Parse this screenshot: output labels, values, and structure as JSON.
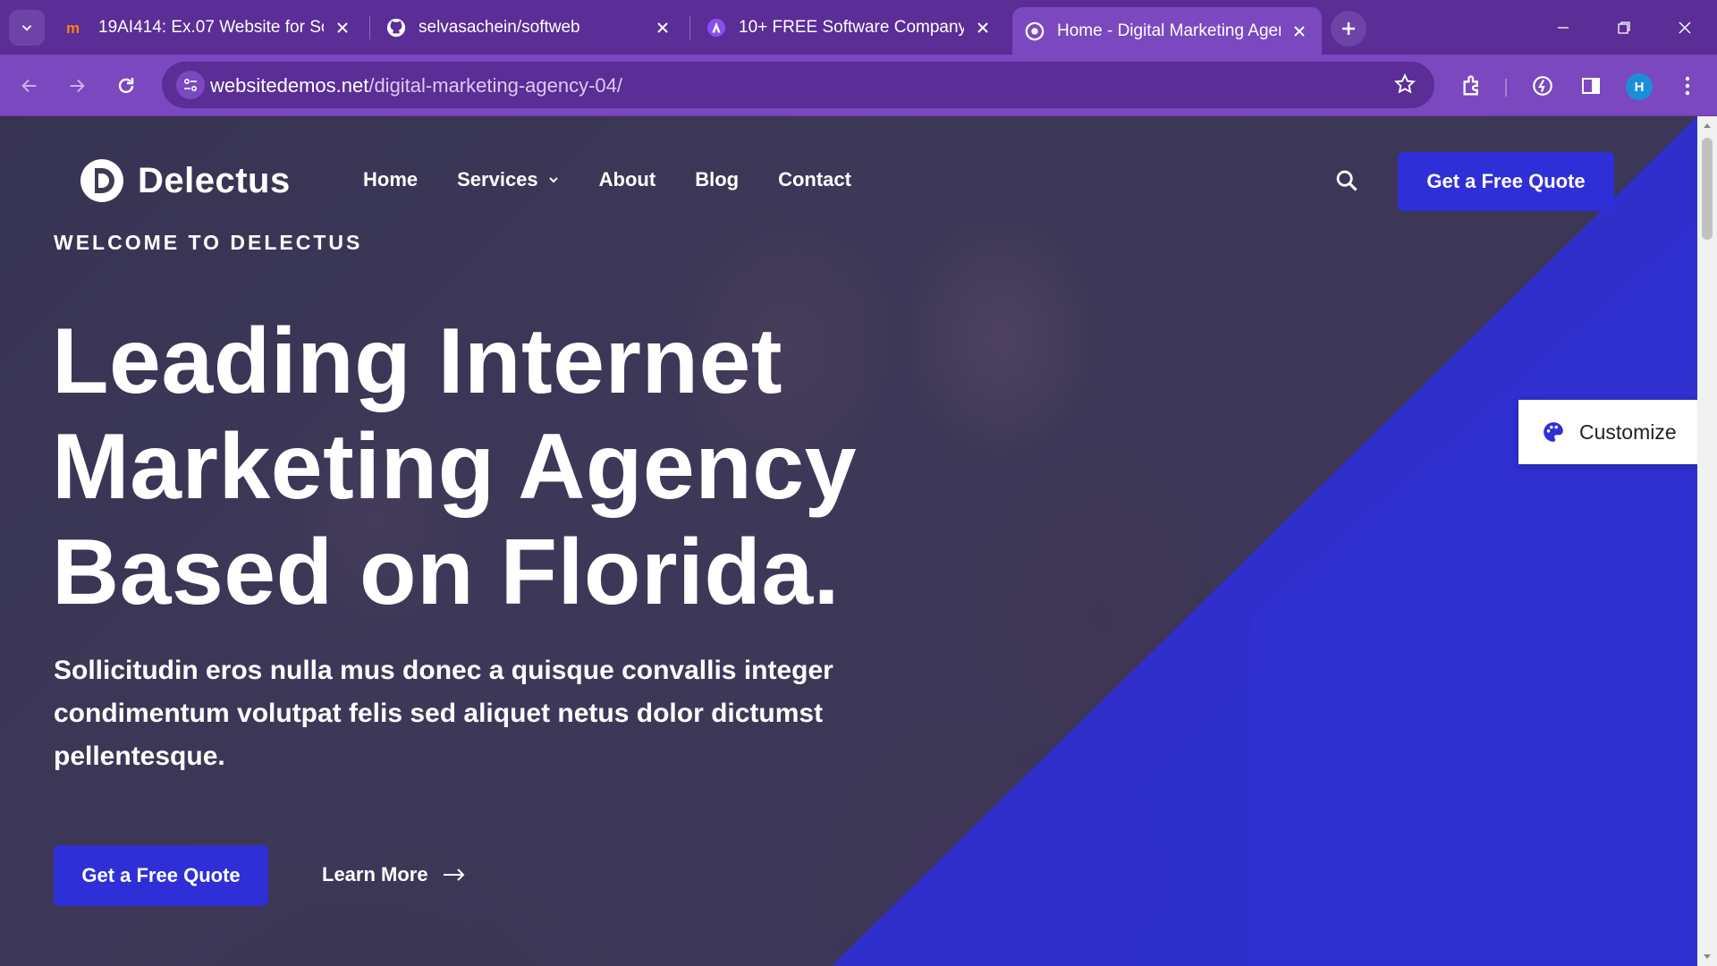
{
  "browser": {
    "tabs": [
      {
        "title": "19AI414: Ex.07 Website for Soft",
        "favicon": "moodle-icon"
      },
      {
        "title": "selvasachein/softweb",
        "favicon": "github-icon"
      },
      {
        "title": "10+ FREE Software Company W",
        "favicon": "astra-icon"
      },
      {
        "title": "Home - Digital Marketing Agen",
        "favicon": "site-icon",
        "active": true
      }
    ],
    "url_host": "websitedemos.net",
    "url_path": "/digital-marketing-agency-04/",
    "profile_initial": "H",
    "accent": "#7b48c0"
  },
  "site": {
    "brand": "Delectus",
    "nav": [
      "Home",
      "Services",
      "About",
      "Blog",
      "Contact"
    ],
    "header_cta": "Get a Free Quote",
    "eyebrow": "WELCOME TO DELECTUS",
    "headline_lines": [
      "Leading Internet",
      "Marketing Agency",
      "Based on Florida."
    ],
    "lead": "Sollicitudin eros nulla mus donec a quisque convallis integer condimentum volutpat felis sed aliquet netus dolor dictumst pellentesque.",
    "cta_primary": "Get a Free Quote",
    "cta_secondary": "Learn More",
    "customize_label": "Customize",
    "primary_color": "#2f2fd8"
  }
}
